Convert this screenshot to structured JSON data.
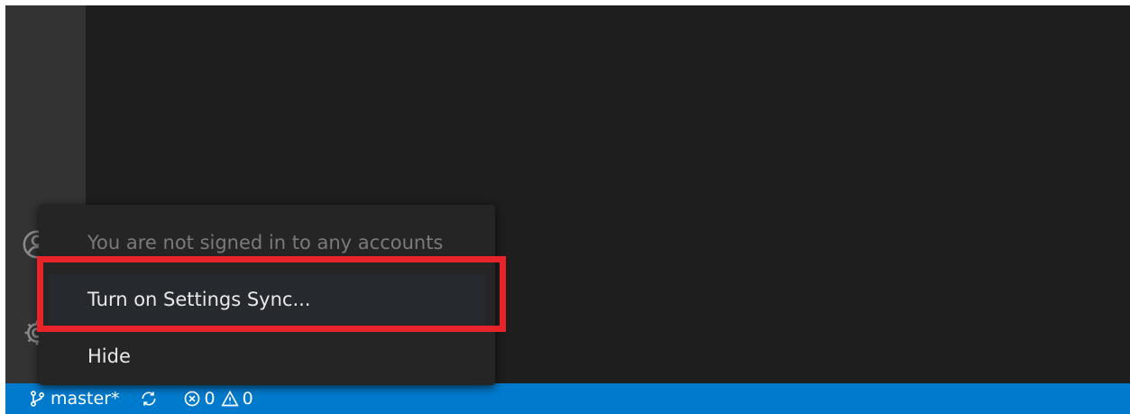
{
  "status_bar": {
    "branch": "master*",
    "errors": "0",
    "warnings": "0"
  },
  "accounts_menu": {
    "items": [
      {
        "label": "You are not signed in to any accounts",
        "enabled": false
      },
      {
        "label": "Turn on Settings Sync...",
        "enabled": true
      },
      {
        "label": "Hide",
        "enabled": true
      }
    ]
  },
  "colors": {
    "status_bar": "#007acc",
    "highlight": "#e8232a"
  }
}
